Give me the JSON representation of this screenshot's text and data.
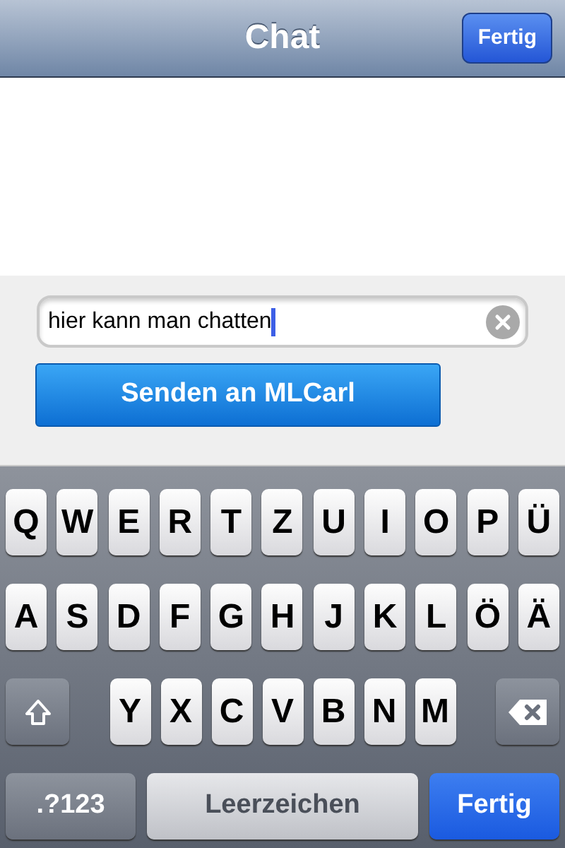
{
  "nav_bar": {
    "title": "Chat",
    "done_button": "Fertig"
  },
  "message_field": {
    "value": "hier kann man chatten",
    "focused": true
  },
  "send_button": "Senden an MLCarl",
  "keyboard": {
    "rows": [
      {
        "keys": [
          {
            "kind": "letter",
            "label": "Q"
          },
          {
            "kind": "letter",
            "label": "W"
          },
          {
            "kind": "letter",
            "label": "E"
          },
          {
            "kind": "letter",
            "label": "R"
          },
          {
            "kind": "letter",
            "label": "T"
          },
          {
            "kind": "letter",
            "label": "Z"
          },
          {
            "kind": "letter",
            "label": "U"
          },
          {
            "kind": "letter",
            "label": "I"
          },
          {
            "kind": "letter",
            "label": "O"
          },
          {
            "kind": "letter",
            "label": "P"
          },
          {
            "kind": "letter",
            "label": "Ü"
          }
        ]
      },
      {
        "keys": [
          {
            "kind": "letter",
            "label": "A"
          },
          {
            "kind": "letter",
            "label": "S"
          },
          {
            "kind": "letter",
            "label": "D"
          },
          {
            "kind": "letter",
            "label": "F"
          },
          {
            "kind": "letter",
            "label": "G"
          },
          {
            "kind": "letter",
            "label": "H"
          },
          {
            "kind": "letter",
            "label": "J"
          },
          {
            "kind": "letter",
            "label": "K"
          },
          {
            "kind": "letter",
            "label": "L"
          },
          {
            "kind": "letter",
            "label": "Ö"
          },
          {
            "kind": "letter",
            "label": "Ä"
          }
        ]
      },
      {
        "keys": [
          {
            "kind": "shift"
          },
          {
            "kind": "letter",
            "label": "Y"
          },
          {
            "kind": "letter",
            "label": "X"
          },
          {
            "kind": "letter",
            "label": "C"
          },
          {
            "kind": "letter",
            "label": "V"
          },
          {
            "kind": "letter",
            "label": "B"
          },
          {
            "kind": "letter",
            "label": "N"
          },
          {
            "kind": "letter",
            "label": "M"
          },
          {
            "kind": "backspace"
          }
        ]
      },
      {
        "keys": [
          {
            "kind": "mode",
            "label": ".?123"
          },
          {
            "kind": "space",
            "label": "Leerzeichen"
          },
          {
            "kind": "return",
            "label": "Fertig"
          }
        ]
      }
    ]
  }
}
